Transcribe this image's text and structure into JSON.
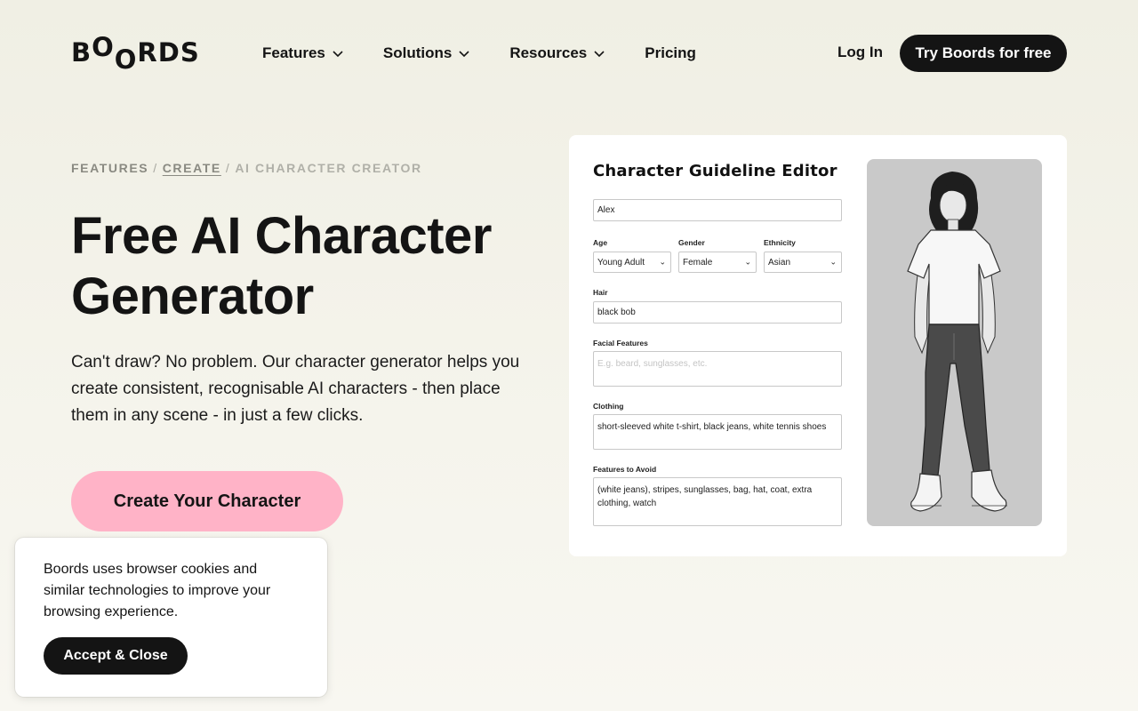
{
  "nav": {
    "logo_letters": [
      "B",
      "O",
      "O",
      "R",
      "D",
      "S"
    ],
    "items": [
      {
        "label": "Features",
        "has_dropdown": true
      },
      {
        "label": "Solutions",
        "has_dropdown": true
      },
      {
        "label": "Resources",
        "has_dropdown": true
      },
      {
        "label": "Pricing",
        "has_dropdown": false
      }
    ],
    "login_label": "Log In",
    "cta_label": "Try Boords for free"
  },
  "breadcrumb": {
    "items": [
      "FEATURES",
      "CREATE",
      "AI CHARACTER CREATOR"
    ],
    "separator": "/"
  },
  "hero": {
    "title": "Free AI Character Generator",
    "description": "Can't draw? No problem. Our character generator helps you create consistent, recognisable AI characters - then place them in any scene - in just a few clicks.",
    "cta_label": "Create Your Character"
  },
  "editor": {
    "title": "Character Guideline Editor",
    "name_value": "Alex",
    "age": {
      "label": "Age",
      "value": "Young Adult"
    },
    "gender": {
      "label": "Gender",
      "value": "Female"
    },
    "ethnicity": {
      "label": "Ethnicity",
      "value": "Asian"
    },
    "hair": {
      "label": "Hair",
      "value": "black bob"
    },
    "facial": {
      "label": "Facial Features",
      "placeholder": "E.g. beard, sunglasses, etc."
    },
    "clothing": {
      "label": "Clothing",
      "value": "short-sleeved white t-shirt, black jeans, white tennis shoes"
    },
    "avoid": {
      "label": "Features to Avoid",
      "value": "(white jeans), stripes, sunglasses, bag, hat, coat, extra clothing, watch"
    }
  },
  "cookie": {
    "text": "Boords uses browser cookies and similar technologies to improve your browsing experience.",
    "button_label": "Accept & Close"
  },
  "colors": {
    "background": "#f2f1e8",
    "dark": "#141414",
    "cta_pink": "#ffb3c7",
    "card": "#ffffff"
  },
  "icons": [
    "chevron-down-icon",
    "character-illustration"
  ]
}
